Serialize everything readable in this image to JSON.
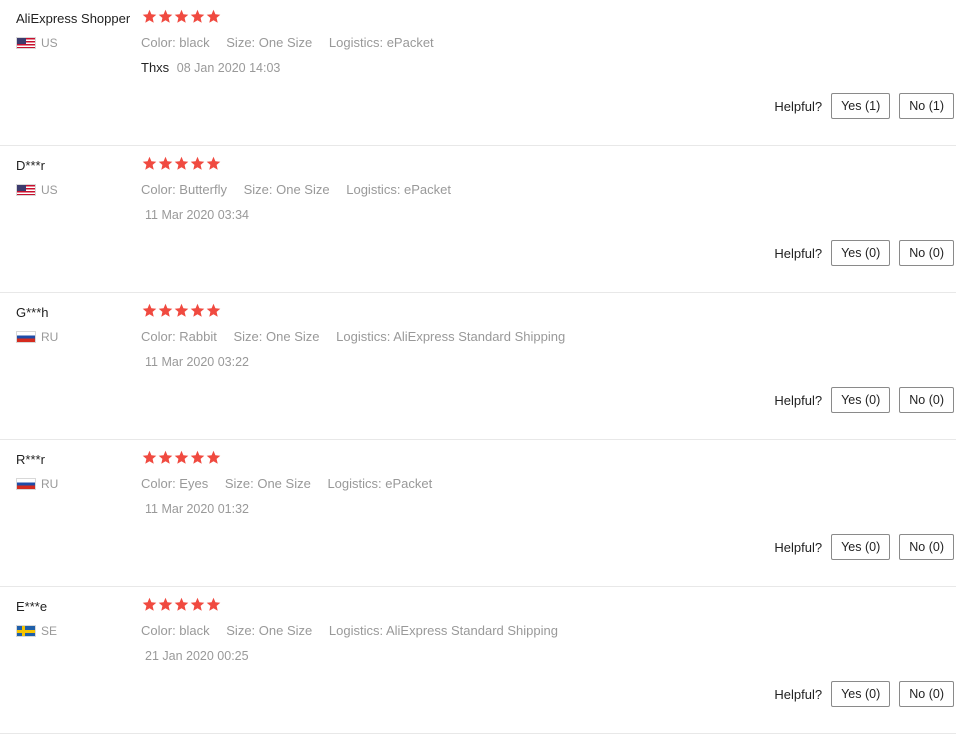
{
  "reviews": [
    {
      "user": "AliExpress Shopper",
      "country": "US",
      "flag": "us",
      "rating": 5,
      "attrs": [
        "Color: black",
        "Size: One Size",
        "Logistics: ePacket"
      ],
      "text": "Thxs",
      "date": "08 Jan 2020 14:03",
      "helpful_label": "Helpful?",
      "yes": "Yes (1)",
      "no": "No (1)"
    },
    {
      "user": "D***r",
      "country": "US",
      "flag": "us",
      "rating": 5,
      "attrs": [
        "Color: Butterfly",
        "Size: One Size",
        "Logistics: ePacket"
      ],
      "text": "",
      "date": "11 Mar 2020 03:34",
      "helpful_label": "Helpful?",
      "yes": "Yes (0)",
      "no": "No (0)"
    },
    {
      "user": "G***h",
      "country": "RU",
      "flag": "ru",
      "rating": 5,
      "attrs": [
        "Color: Rabbit",
        "Size: One Size",
        "Logistics: AliExpress Standard Shipping"
      ],
      "text": "",
      "date": "11 Mar 2020 03:22",
      "helpful_label": "Helpful?",
      "yes": "Yes (0)",
      "no": "No (0)"
    },
    {
      "user": "R***r",
      "country": "RU",
      "flag": "ru",
      "rating": 5,
      "attrs": [
        "Color: Eyes",
        "Size: One Size",
        "Logistics: ePacket"
      ],
      "text": "",
      "date": "11 Mar 2020 01:32",
      "helpful_label": "Helpful?",
      "yes": "Yes (0)",
      "no": "No (0)"
    },
    {
      "user": "E***e",
      "country": "SE",
      "flag": "se",
      "rating": 5,
      "attrs": [
        "Color: black",
        "Size: One Size",
        "Logistics: AliExpress Standard Shipping"
      ],
      "text": "",
      "date": "21 Jan 2020 00:25",
      "helpful_label": "Helpful?",
      "yes": "Yes (0)",
      "no": "No (0)"
    }
  ],
  "colors": {
    "star": "#f04a40",
    "muted_text": "#999999",
    "divider": "#e8e8e8"
  },
  "icons": {
    "star": "star-icon",
    "flag": "country-flag-icon"
  }
}
